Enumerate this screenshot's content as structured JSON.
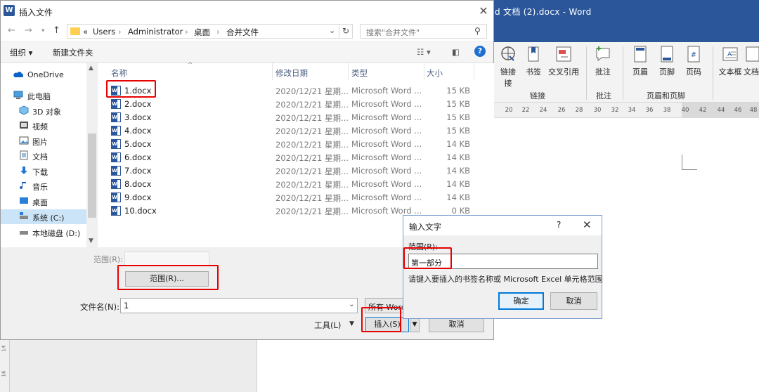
{
  "word": {
    "title": "d 文档 (2).docx  -  Word",
    "ribbon": [
      {
        "label": "链接",
        "icon": "link-icon"
      },
      {
        "label": "书签",
        "icon": "bookmark-icon"
      },
      {
        "label": "交叉引用",
        "icon": "cross-reference-icon"
      },
      {
        "label": "批注",
        "icon": "comment-icon"
      },
      {
        "label": "页眉",
        "icon": "header-icon"
      },
      {
        "label": "页脚",
        "icon": "footer-icon"
      },
      {
        "label": "页码",
        "icon": "page-number-icon"
      },
      {
        "label": "文本框",
        "icon": "textbox-icon"
      },
      {
        "label": "文档",
        "icon": "doc-part-icon"
      }
    ],
    "link_sub": "接",
    "groups": [
      "链接",
      "批注",
      "页眉和页脚"
    ],
    "ruler": [
      "20",
      "22",
      "24",
      "26",
      "28",
      "30",
      "32",
      "34",
      "36",
      "38",
      "40",
      "42",
      "44",
      "46",
      "48"
    ],
    "vruler": [
      "14",
      "16"
    ]
  },
  "dialog": {
    "title": "插入文件",
    "path": [
      "Users",
      "Administrator",
      "桌面",
      "合并文件"
    ],
    "path_prefix": "«",
    "search_placeholder": "搜索\"合并文件\"",
    "toolbar": {
      "organize": "组织 ▾",
      "new_folder": "新建文件夹"
    },
    "sidebar": [
      {
        "label": "OneDrive",
        "icon": "onedrive-icon"
      },
      {
        "label": "此电脑",
        "icon": "computer-icon"
      },
      {
        "label": "3D 对象",
        "icon": "3d-objects-icon"
      },
      {
        "label": "视频",
        "icon": "video-icon"
      },
      {
        "label": "图片",
        "icon": "pictures-icon"
      },
      {
        "label": "文档",
        "icon": "documents-icon"
      },
      {
        "label": "下载",
        "icon": "download-icon"
      },
      {
        "label": "音乐",
        "icon": "music-icon"
      },
      {
        "label": "桌面",
        "icon": "desktop-icon"
      },
      {
        "label": "系统 (C:)",
        "icon": "system-drive-icon",
        "selected": true
      },
      {
        "label": "本地磁盘 (D:)",
        "icon": "local-disk-icon"
      }
    ],
    "columns": {
      "name": "名称",
      "date": "修改日期",
      "type": "类型",
      "size": "大小"
    },
    "files": [
      {
        "name": "1.docx",
        "date": "2020/12/21 星期...",
        "type": "Microsoft Word ...",
        "size": "15 KB"
      },
      {
        "name": "2.docx",
        "date": "2020/12/21 星期...",
        "type": "Microsoft Word ...",
        "size": "15 KB"
      },
      {
        "name": "3.docx",
        "date": "2020/12/21 星期...",
        "type": "Microsoft Word ...",
        "size": "15 KB"
      },
      {
        "name": "4.docx",
        "date": "2020/12/21 星期...",
        "type": "Microsoft Word ...",
        "size": "15 KB"
      },
      {
        "name": "5.docx",
        "date": "2020/12/21 星期...",
        "type": "Microsoft Word ...",
        "size": "14 KB"
      },
      {
        "name": "6.docx",
        "date": "2020/12/21 星期...",
        "type": "Microsoft Word ...",
        "size": "14 KB"
      },
      {
        "name": "7.docx",
        "date": "2020/12/21 星期...",
        "type": "Microsoft Word ...",
        "size": "14 KB"
      },
      {
        "name": "8.docx",
        "date": "2020/12/21 星期...",
        "type": "Microsoft Word ...",
        "size": "14 KB"
      },
      {
        "name": "9.docx",
        "date": "2020/12/21 星期...",
        "type": "Microsoft Word ...",
        "size": "14 KB"
      },
      {
        "name": "10.docx",
        "date": "2020/12/21 星期...",
        "type": "Microsoft Word ...",
        "size": "0 KB"
      }
    ],
    "range_label": "范围(R):",
    "range_button": "范围(R)...",
    "filename_label": "文件名(N):",
    "filename_value": "1",
    "filetype_value": "所有 Word",
    "tools": "工具(L)",
    "insert": "插入(S)",
    "cancel": "取消"
  },
  "input_dialog": {
    "title": "输入文字",
    "help": "?",
    "range_label": "范围(R):",
    "value": "第一部分",
    "hint": "请键入要插入的书签名称或 Microsoft Excel 单元格范围",
    "ok": "确定",
    "cancel": "取消"
  },
  "colors": {
    "word_blue": "#2b579a",
    "highlight": "#e60000",
    "selection": "#cce4f7"
  }
}
